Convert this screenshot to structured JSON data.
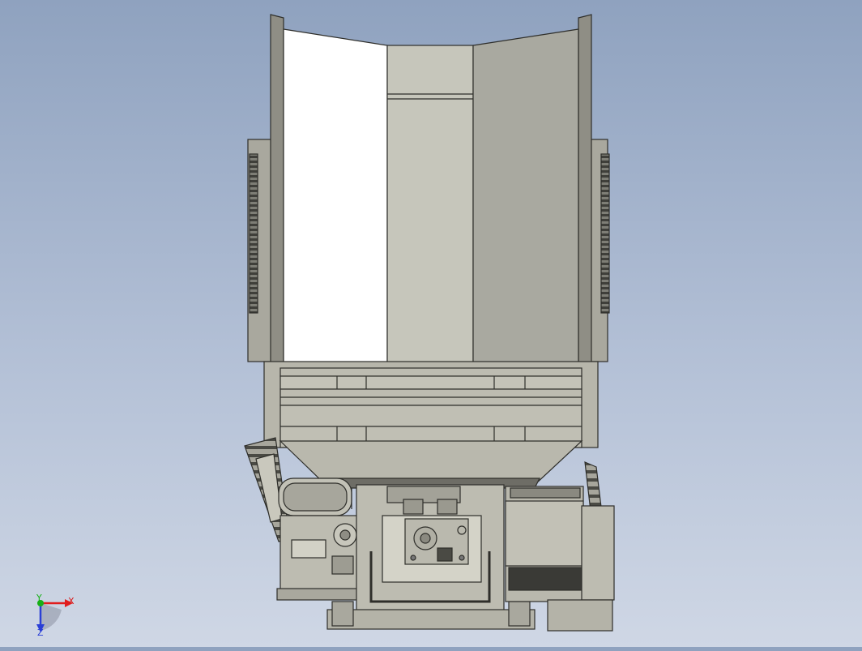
{
  "viewport": {
    "background_top": "#8fa2bf",
    "background_bottom": "#cfd7e5",
    "part_fill": "#b4b3a8",
    "part_stroke": "#2e2e2a",
    "hopper_left_panel": "#ffffff",
    "hopper_right_panel": "#a9a9a0"
  },
  "triad": {
    "x_label": "X",
    "y_label": "Y",
    "z_label": "Z",
    "x_color": "#e11d1d",
    "y_color": "#17b017",
    "z_color": "#2a3fd6"
  }
}
